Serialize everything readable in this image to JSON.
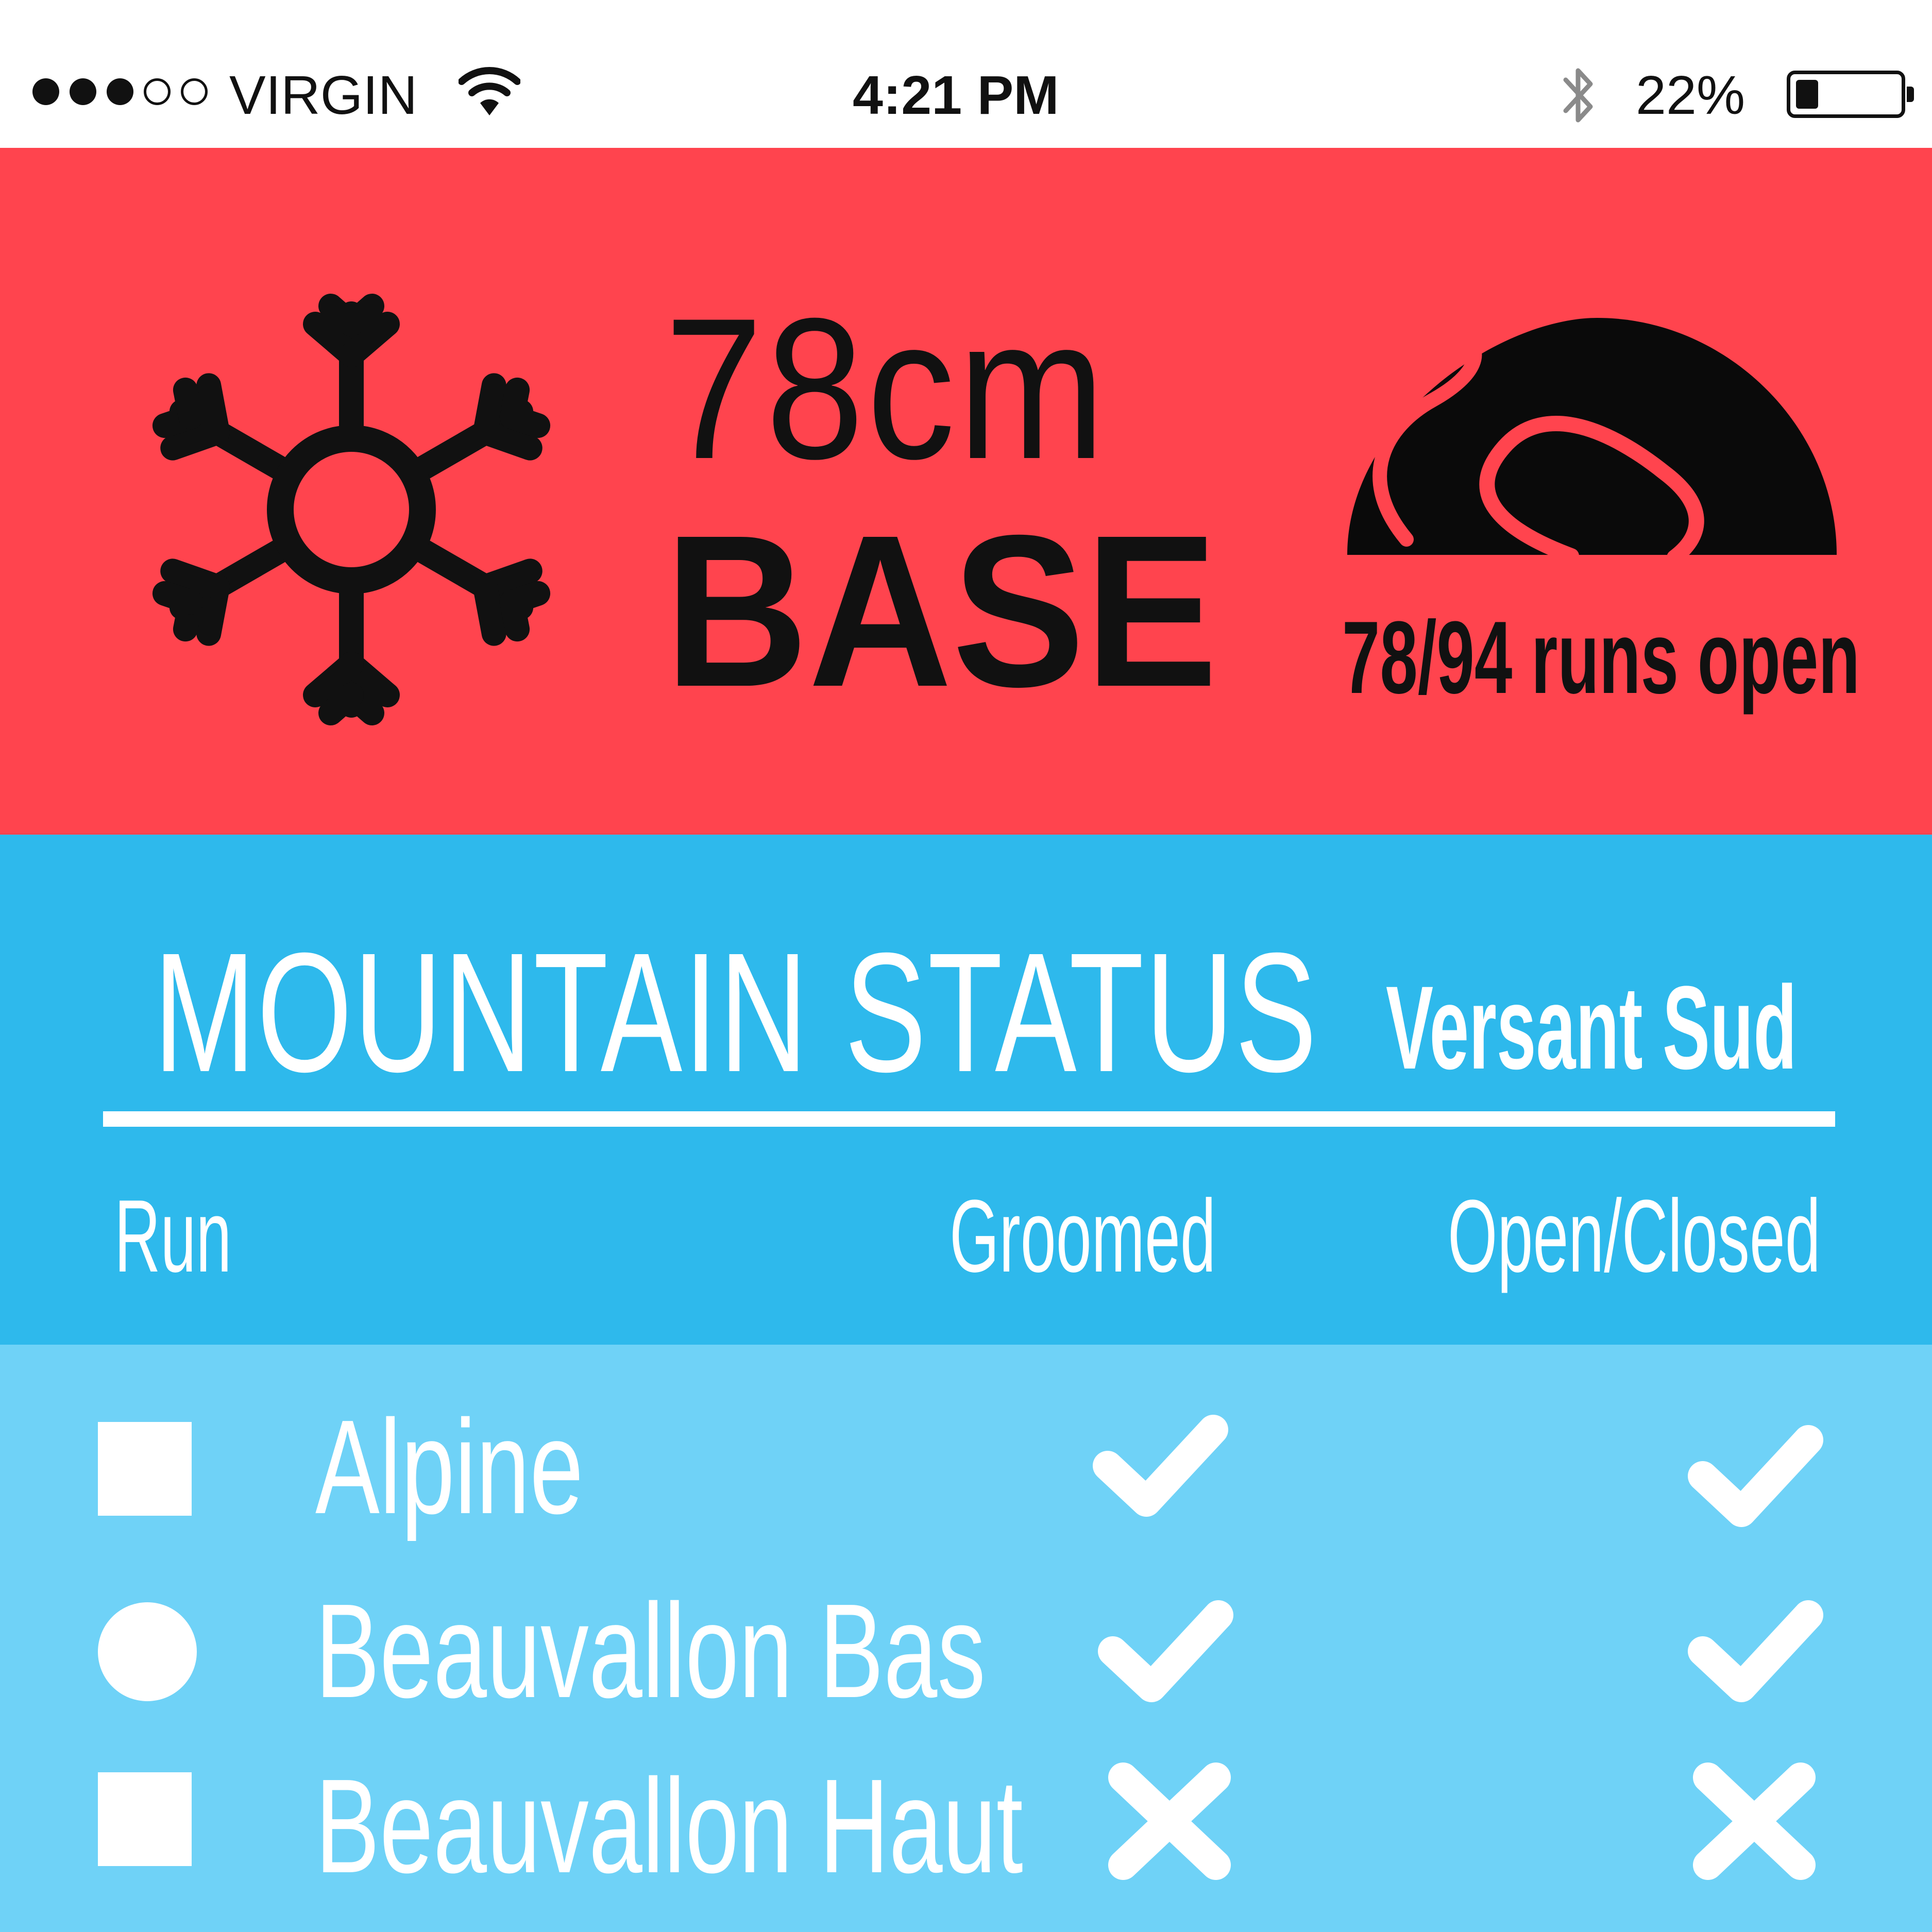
{
  "status_bar": {
    "signal_filled": 3,
    "signal_total": 5,
    "carrier": "VIRGIN",
    "wifi_icon": "wifi-icon",
    "time": "4:21 PM",
    "bluetooth_icon": "bluetooth-icon",
    "battery_percent": "22%",
    "battery_level": 0.22
  },
  "snow": {
    "icon": "snowflake-icon",
    "depth": "78cm",
    "depth_label": "BASE",
    "runs_icon": "mountain-icon",
    "runs_open": "78/94 runs open"
  },
  "mountain_status": {
    "title": "MOUNTAIN STATUS",
    "area": "Versant Sud",
    "columns": {
      "run": "Run",
      "groomed": "Groomed",
      "open_closed": "Open/Closed"
    },
    "runs": [
      {
        "difficulty_shape": "square",
        "name": "Alpine",
        "groomed": true,
        "open": true
      },
      {
        "difficulty_shape": "circle",
        "name": "Beauvallon Bas",
        "groomed": true,
        "open": true
      },
      {
        "difficulty_shape": "square",
        "name": "Beauvallon Haut",
        "groomed": false,
        "open": false
      }
    ]
  },
  "colors": {
    "snow_panel": "#ff444e",
    "status_header": "#2eb9ec",
    "run_list": "#6fd2f7",
    "ink": "#111111",
    "white": "#ffffff"
  }
}
